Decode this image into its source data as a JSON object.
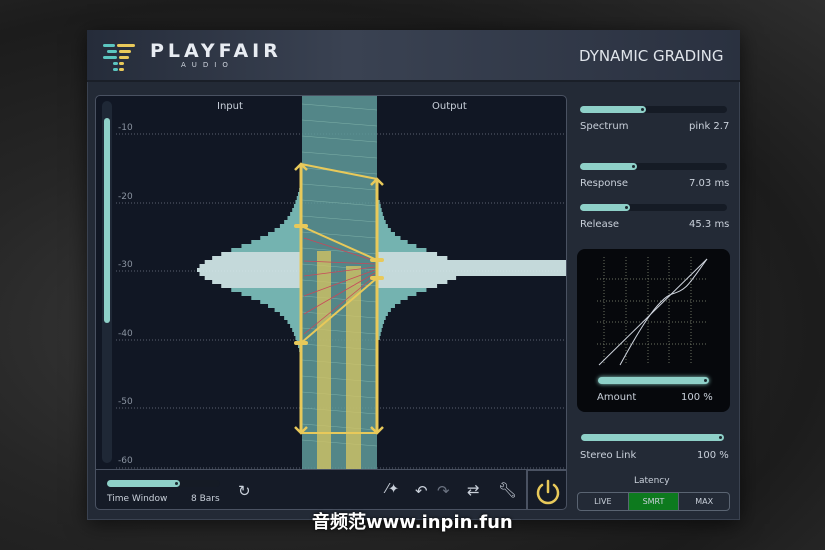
{
  "header": {
    "brand": "PLAYFAIR",
    "brand_sub": "AUDIO",
    "title": "DYNAMIC GRADING"
  },
  "display": {
    "input_label": "Input",
    "output_label": "Output",
    "gridlines": [
      "-10",
      "-20",
      "-30",
      "-40",
      "-50",
      "-60"
    ]
  },
  "controls": {
    "spectrum": {
      "label": "Spectrum",
      "value": "pink 2.7",
      "fill": 0.45
    },
    "response": {
      "label": "Response",
      "value": "7.03 ms",
      "fill": 0.39
    },
    "release": {
      "label": "Release",
      "value": "45.3 ms",
      "fill": 0.34
    },
    "amount": {
      "label": "Amount",
      "value": "100 %",
      "fill": 1.0
    },
    "stereo_link": {
      "label": "Stereo Link",
      "value": "100 %",
      "fill": 1.0
    }
  },
  "latency": {
    "label": "Latency",
    "options": [
      "LIVE",
      "SMRT",
      "MAX"
    ],
    "selected": "SMRT"
  },
  "toolbar": {
    "time_window_label": "Time Window",
    "time_window_value": "8 Bars",
    "time_window_fill": 0.65
  },
  "colors": {
    "accent": "#8ed0c8",
    "handles": "#e8c95a",
    "selected": "#0d7a1e"
  },
  "watermark": "音频范www.inpin.fun"
}
